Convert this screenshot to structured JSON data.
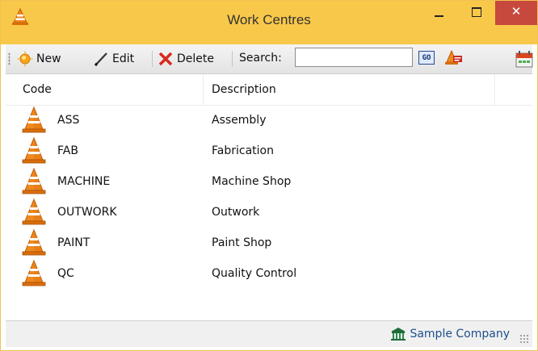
{
  "window": {
    "title": "Work Centres",
    "controls": {
      "minimize": "–",
      "maximize": "□",
      "close": "✕"
    }
  },
  "toolbar": {
    "new_label": "New",
    "edit_label": "Edit",
    "delete_label": "Delete",
    "search_label": "Search:",
    "search_value": "",
    "go_label": "GO"
  },
  "grid": {
    "columns": [
      "Code",
      "Description"
    ],
    "rows": [
      {
        "code": "ASS",
        "description": "Assembly"
      },
      {
        "code": "FAB",
        "description": "Fabrication"
      },
      {
        "code": "MACHINE",
        "description": "Machine Shop"
      },
      {
        "code": "OUTWORK",
        "description": "Outwork"
      },
      {
        "code": "PAINT",
        "description": "Paint Shop"
      },
      {
        "code": "QC",
        "description": "Quality Control"
      }
    ]
  },
  "statusbar": {
    "company": "Sample Company"
  },
  "icons": {
    "row_icon": "traffic-cone-icon",
    "title_icon": "traffic-cone-icon",
    "new_icon": "sun-icon",
    "edit_icon": "pencil-icon",
    "delete_icon": "red-x-icon",
    "company_icon": "bank-building-icon"
  },
  "colors": {
    "titlebar": "#f8c84a",
    "close_button": "#c7493d",
    "company_text": "#1d4f8c"
  }
}
